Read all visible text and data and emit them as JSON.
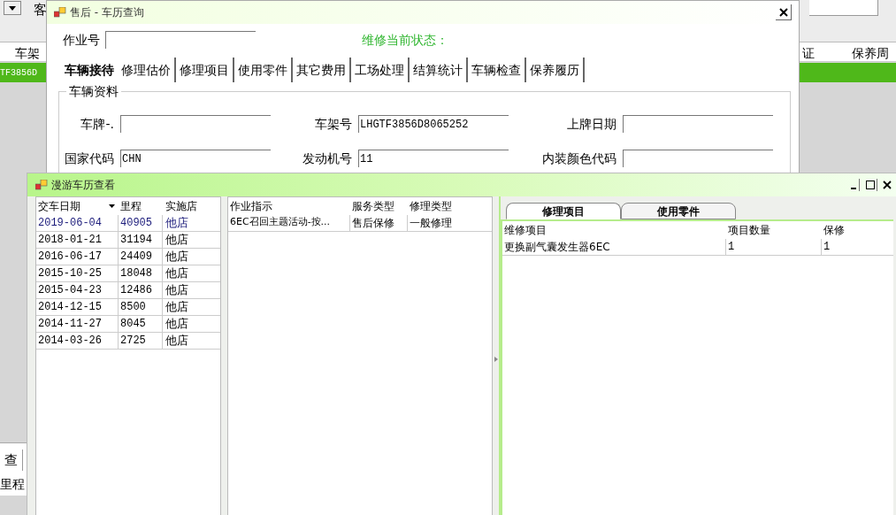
{
  "background": {
    "top_label": "客",
    "columns": [
      "车架",
      "证",
      "保养周"
    ],
    "selected_row": {
      "cell": "TF3856D",
      "selected": true
    },
    "bottom_tab": "查",
    "bottom_label": "里程"
  },
  "history_query": {
    "title": "售后 - 车历查询",
    "job_label": "作业号",
    "status_label": "维修当前状态：",
    "tabs": [
      {
        "label": "车辆接待",
        "selected": true
      },
      {
        "label": "修理估价",
        "selected": false
      },
      {
        "label": "修理项目",
        "selected": false
      },
      {
        "label": "使用零件",
        "selected": false
      },
      {
        "label": "其它费用",
        "selected": false
      },
      {
        "label": "工场处理",
        "selected": false
      },
      {
        "label": "结算统计",
        "selected": false
      },
      {
        "label": "车辆检查",
        "selected": false
      },
      {
        "label": "保养履历",
        "selected": false
      }
    ],
    "group_title": "车辆资料",
    "fields": [
      {
        "label": "车牌-."
      },
      {
        "label": "车架号",
        "value": "LHGTF3856D8065252"
      },
      {
        "label": "上牌日期"
      },
      {
        "label": "国家代码",
        "value": "CHN"
      },
      {
        "label": "发动机号",
        "value": "11"
      },
      {
        "label": "内装颜色代码"
      }
    ]
  },
  "roaming_history": {
    "title": "漫游车历查看",
    "visits": {
      "columns": [
        "交车日期",
        "里程",
        "实施店"
      ],
      "rows": [
        {
          "date": "2019-06-04",
          "mileage": "40905",
          "shop": "他店",
          "selected": true
        },
        {
          "date": "2018-01-21",
          "mileage": "31194",
          "shop": "他店",
          "selected": false
        },
        {
          "date": "2016-06-17",
          "mileage": "24409",
          "shop": "他店",
          "selected": false
        },
        {
          "date": "2015-10-25",
          "mileage": "18048",
          "shop": "他店",
          "selected": false
        },
        {
          "date": "2015-04-23",
          "mileage": "12486",
          "shop": "他店",
          "selected": false
        },
        {
          "date": "2014-12-15",
          "mileage": "8500",
          "shop": "他店",
          "selected": false
        },
        {
          "date": "2014-11-27",
          "mileage": "8045",
          "shop": "他店",
          "selected": false
        },
        {
          "date": "2014-03-26",
          "mileage": "2725",
          "shop": "他店",
          "selected": false
        }
      ]
    },
    "orders": {
      "columns": [
        "作业指示",
        "服务类型",
        "修理类型"
      ],
      "rows": [
        [
          "6EC召回主题活动-按...",
          "售后保修",
          "一般修理"
        ]
      ]
    },
    "detail_tabs": [
      {
        "label": "修理项目",
        "selected": true
      },
      {
        "label": "使用零件",
        "selected": false
      }
    ],
    "items": {
      "columns": [
        "维修项目",
        "项目数量",
        "保修"
      ],
      "rows": [
        [
          "更换副气囊发生器6EC",
          "1",
          "1"
        ]
      ]
    }
  }
}
